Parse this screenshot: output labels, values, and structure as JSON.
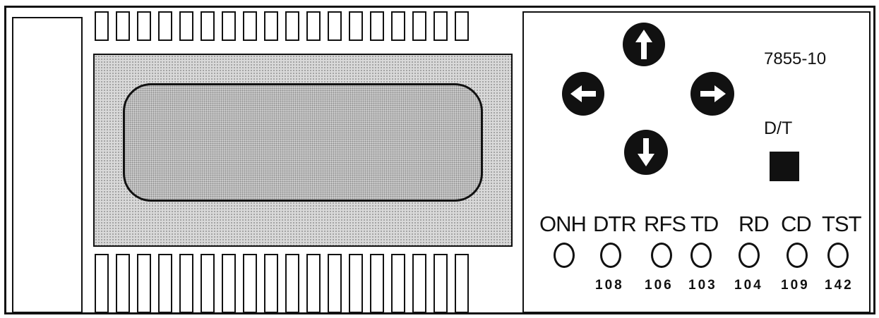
{
  "device": {
    "model": "7855-10",
    "dt_label": "D/T"
  },
  "arrows": {
    "up": "up-arrow-icon",
    "left": "left-arrow-icon",
    "right": "right-arrow-icon",
    "down": "down-arrow-icon"
  },
  "indicators": [
    {
      "label": "ONH",
      "circuit": ""
    },
    {
      "label": "DTR",
      "circuit": "108"
    },
    {
      "label": "RFS",
      "circuit": "106"
    },
    {
      "label": "TD",
      "circuit": "103"
    },
    {
      "label": "RD",
      "circuit": "104"
    },
    {
      "label": "CD",
      "circuit": "109"
    },
    {
      "label": "TST",
      "circuit": "142"
    }
  ],
  "colors": {
    "ink": "#111111",
    "display_shading": "#cfcfcf"
  }
}
